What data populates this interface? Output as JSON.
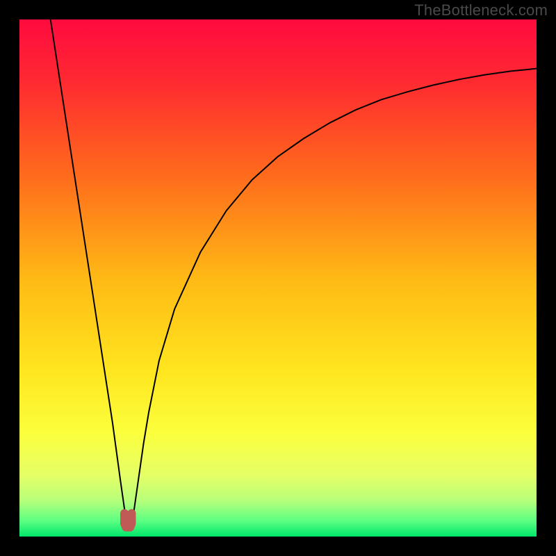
{
  "watermark": "TheBottleneck.com",
  "chart_data": {
    "type": "line",
    "title": "",
    "xlabel": "",
    "ylabel": "",
    "xlim": [
      0,
      100
    ],
    "ylim": [
      0,
      100
    ],
    "grid": false,
    "legend": false,
    "series": [
      {
        "name": "bottleneck-curve",
        "x": [
          6,
          8,
          10,
          12,
          14,
          16,
          18,
          19.5,
          20.5,
          21,
          21.5,
          22,
          23,
          24,
          25,
          27,
          30,
          35,
          40,
          45,
          50,
          55,
          60,
          65,
          70,
          75,
          80,
          85,
          90,
          95,
          100
        ],
        "y": [
          100,
          87,
          74,
          61,
          48,
          35,
          22,
          11,
          4,
          2,
          2,
          4,
          11,
          18,
          24,
          34,
          44,
          55,
          63,
          69,
          73.5,
          77,
          80,
          82.5,
          84.5,
          86,
          87.3,
          88.4,
          89.3,
          90,
          90.5
        ]
      },
      {
        "name": "minimum-marker",
        "x": [
          20.3,
          20.3,
          20.6,
          21.4,
          21.7,
          21.7
        ],
        "y": [
          4.5,
          2.5,
          1.8,
          1.8,
          2.5,
          4.5
        ]
      }
    ],
    "gradient_stops": [
      {
        "pos": 0.0,
        "color": "#ff0a3f"
      },
      {
        "pos": 0.12,
        "color": "#ff2a31"
      },
      {
        "pos": 0.3,
        "color": "#ff6a1c"
      },
      {
        "pos": 0.5,
        "color": "#ffb915"
      },
      {
        "pos": 0.68,
        "color": "#ffe61e"
      },
      {
        "pos": 0.8,
        "color": "#fbff3d"
      },
      {
        "pos": 0.88,
        "color": "#e6ff66"
      },
      {
        "pos": 0.93,
        "color": "#b8ff7a"
      },
      {
        "pos": 0.97,
        "color": "#5bff82"
      },
      {
        "pos": 1.0,
        "color": "#00e66a"
      }
    ],
    "colors": {
      "curve": "#000000",
      "marker": "#c05a56",
      "frame_bg": "#000000"
    }
  }
}
